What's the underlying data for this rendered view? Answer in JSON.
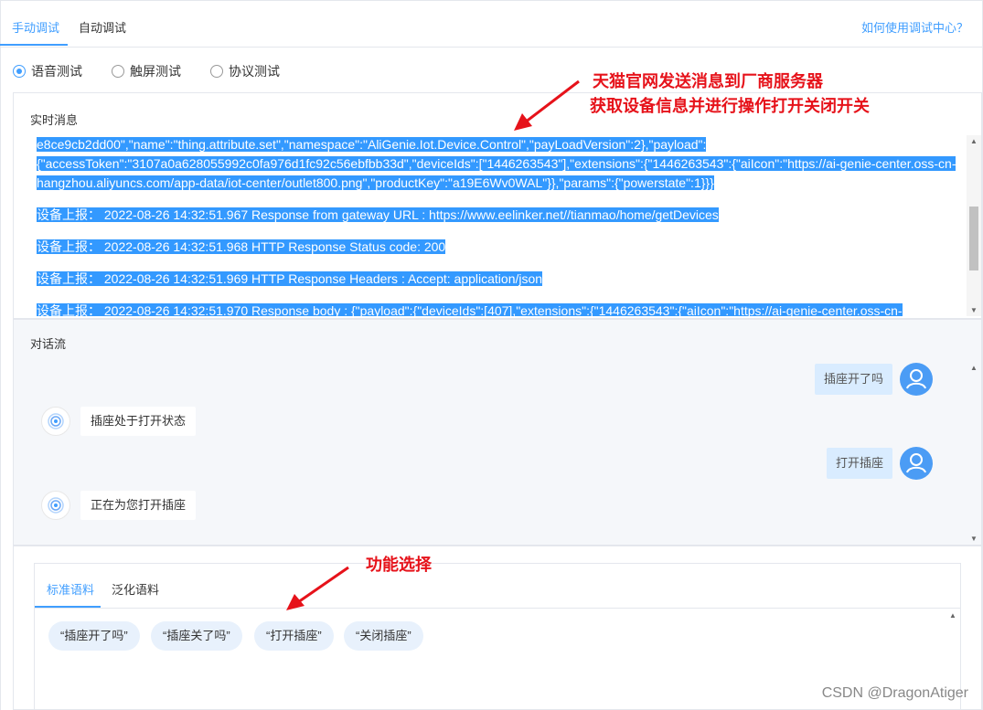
{
  "top_tabs": [
    {
      "label": "手动调试",
      "active": true
    },
    {
      "label": "自动调试",
      "active": false
    }
  ],
  "help_link": "如何使用调试中心？",
  "test_modes": [
    {
      "label": "语音测试",
      "checked": true
    },
    {
      "label": "触屏测试",
      "checked": false
    },
    {
      "label": "协议测试",
      "checked": false
    }
  ],
  "realtime": {
    "title": "实时消息",
    "lines": [
      "e8ce9cb2dd00\",\"name\":\"thing.attribute.set\",\"namespace\":\"AliGenie.Iot.Device.Control\",\"payLoadVersion\":2},\"payload\":",
      "{\"accessToken\":\"3107a0a628055992c0fa976d1fc92c56ebfbb33d\",\"deviceIds\":[\"1446263543\"],\"extensions\":{\"1446263543\":{\"aiIcon\":\"https://ai-genie-center.oss-cn-",
      "hangzhou.aliyuncs.com/app-data/iot-center/outlet800.png\",\"productKey\":\"a19E6Wv0WAL\"}},\"params\":{\"powerstate\":1}}}",
      "设备上报： 2022-08-26 14:32:51.967 Response from gateway URL : https://www.eelinker.net//tianmao/home/getDevices",
      "设备上报： 2022-08-26 14:32:51.968 HTTP Response Status code: 200",
      "设备上报： 2022-08-26 14:32:51.969 HTTP Response Headers : Accept: application/json",
      "设备上报： 2022-08-26 14:32:51.970 Response body : {\"payload\":{\"deviceIds\":[407],\"extensions\":{\"1446263543\":{\"aiIcon\":\"https://ai-genie-center.oss-cn-"
    ]
  },
  "dialog": {
    "title": "对话流",
    "messages": [
      {
        "from": "user",
        "text": "插座开了吗"
      },
      {
        "from": "bot",
        "text": "插座处于打开状态"
      },
      {
        "from": "user",
        "text": "打开插座"
      },
      {
        "from": "bot",
        "text": "正在为您打开插座"
      }
    ]
  },
  "function_panel": {
    "tabs": [
      {
        "label": "标准语料",
        "active": true
      },
      {
        "label": "泛化语料",
        "active": false
      }
    ],
    "chips": [
      "“插座开了吗”",
      "“插座关了吗”",
      "“打开插座”",
      "“关闭插座”"
    ]
  },
  "annotations": {
    "top_line1": "天猫官网发送消息到厂商服务器",
    "top_line2": "获取设备信息并进行操作打开关闭开关",
    "function": "功能选择",
    "color": "#e6121a"
  },
  "watermark": "CSDN @DragonAtiger",
  "colors": {
    "accent": "#409eff",
    "highlight": "#3399ff",
    "user_avatar": "#4b9cf5"
  }
}
